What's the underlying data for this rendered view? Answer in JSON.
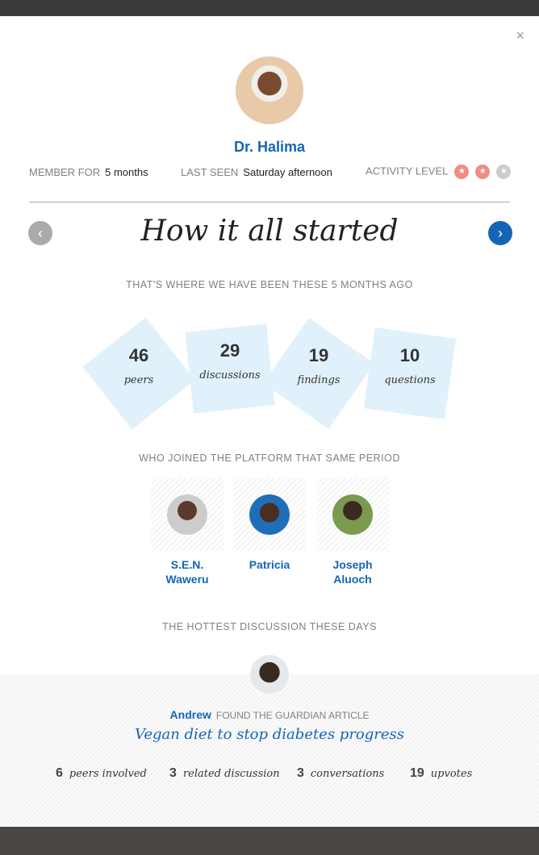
{
  "profile": {
    "name": "Dr. Halima",
    "member_for_label": "MEMBER FOR",
    "member_for": "5 months",
    "last_seen_label": "LAST SEEN",
    "last_seen": "Saturday afternoon",
    "activity_label": "ACTIVITY LEVEL",
    "activity_level": 2,
    "activity_max": 3
  },
  "colors": {
    "accent": "#1565b5",
    "badge_on": "#f28b82",
    "badge_off": "#cccccc",
    "tile": "#e1f1fb"
  },
  "slide": {
    "title": "How it all started",
    "subtitle": "THAT'S WHERE WE HAVE BEEN THESE 5 MONTHS AGO"
  },
  "stats": [
    {
      "n": "46",
      "t": "peers"
    },
    {
      "n": "29",
      "t": "discussions"
    },
    {
      "n": "19",
      "t": "findings"
    },
    {
      "n": "10",
      "t": "questions"
    }
  ],
  "joined": {
    "label": "WHO JOINED THE PLATFORM THAT SAME PERIOD",
    "people": [
      {
        "name": "S.E.N. Waweru"
      },
      {
        "name": "Patricia"
      },
      {
        "name": "Joseph Aluoch"
      }
    ]
  },
  "hot": {
    "label": "THE HOTTEST DISCUSSION THESE DAYS",
    "user": "Andrew",
    "action": "FOUND THE GUARDIAN ARTICLE",
    "title": "Vegan diet to stop diabetes progress",
    "stats": [
      {
        "n": "6",
        "t": "peers involved"
      },
      {
        "n": "3",
        "t": "related discussion"
      },
      {
        "n": "3",
        "t": "conversations"
      },
      {
        "n": "19",
        "t": "upvotes"
      }
    ]
  },
  "close_icon": "×",
  "prev_icon": "‹",
  "next_icon": "›",
  "star_icon": "★"
}
